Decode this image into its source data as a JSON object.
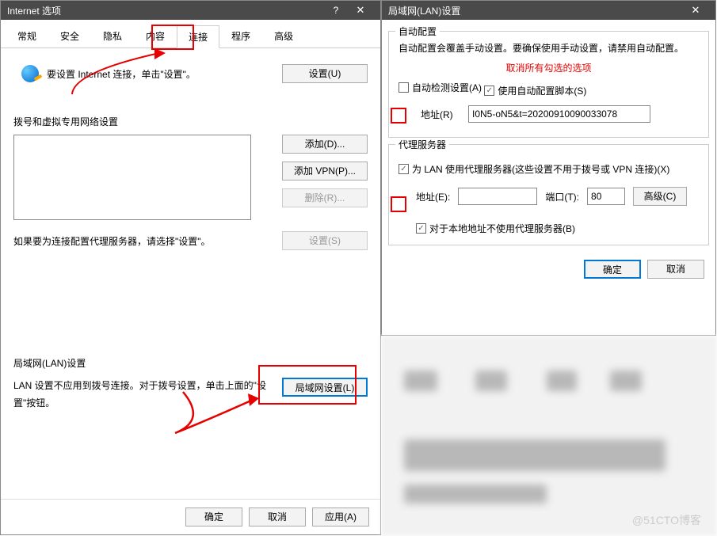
{
  "dialog1": {
    "title": "Internet 选项",
    "tabs": [
      "常规",
      "安全",
      "隐私",
      "内容",
      "连接",
      "程序",
      "高级"
    ],
    "active_tab_index": 4,
    "setup_text": "要设置 Internet 连接，单击\"设置\"。",
    "setup_btn": "设置(U)",
    "dial_heading": "拨号和虚拟专用网络设置",
    "add_btn": "添加(D)...",
    "add_vpn_btn": "添加 VPN(P)...",
    "remove_btn": "删除(R)...",
    "settings_btn": "设置(S)",
    "proxy_note": "如果要为连接配置代理服务器，请选择\"设置\"。",
    "lan_heading": "局域网(LAN)设置",
    "lan_note": "LAN 设置不应用到拨号连接。对于拨号设置，单击上面的\"设置\"按钮。",
    "lan_btn": "局域网设置(L)",
    "ok": "确定",
    "cancel": "取消",
    "apply": "应用(A)"
  },
  "dialog2": {
    "title": "局域网(LAN)设置",
    "auto_group": "自动配置",
    "auto_note": "自动配置会覆盖手动设置。要确保使用手动设置，请禁用自动配置。",
    "red_note": "取消所有勾选的选项",
    "auto_detect": "自动检测设置(A)",
    "use_script": "使用自动配置脚本(S)",
    "addr_label": "地址(R)",
    "addr_value": "I0N5-oN5&t=20200910090033078",
    "proxy_group": "代理服务器",
    "use_proxy": "为 LAN 使用代理服务器(这些设置不用于拨号或 VPN 连接)(X)",
    "proxy_addr_label": "地址(E):",
    "proxy_port_label": "端口(T):",
    "proxy_port_value": "80",
    "advanced_btn": "高级(C)",
    "bypass_local": "对于本地地址不使用代理服务器(B)",
    "ok": "确定",
    "cancel": "取消"
  },
  "watermark": "@51CTO博客"
}
